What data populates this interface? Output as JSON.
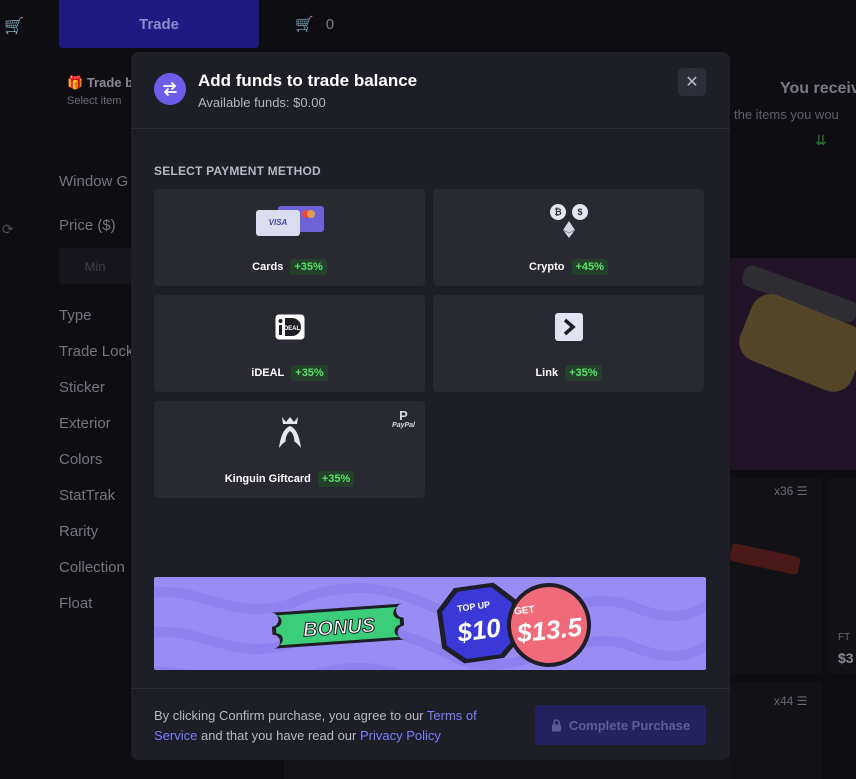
{
  "background": {
    "trade_button": "Trade",
    "cart_count": "0",
    "trade_box_title": "Trade b",
    "trade_box_sub": "Select item",
    "filters": [
      "Window G",
      "Price ($)",
      "Type",
      "Trade Lock",
      "Sticker",
      "Exterior",
      "Colors",
      "StatTrak",
      "Rarity",
      "Collection",
      "Float"
    ],
    "min_placeholder": "Min",
    "right_title": "You receiv",
    "right_subtitle": "the items you wou",
    "item_count_1": "x36",
    "item_count_2": "x44",
    "item_wear": "FT",
    "item_price": "$3"
  },
  "modal": {
    "title": "Add funds to trade balance",
    "subtitle": "Available funds: $0.00",
    "section_label": "SELECT PAYMENT METHOD",
    "methods": [
      {
        "name": "Cards",
        "bonus": "+35%",
        "icon": "cards-icon"
      },
      {
        "name": "Crypto",
        "bonus": "+45%",
        "icon": "crypto-icon"
      },
      {
        "name": "iDEAL",
        "bonus": "+35%",
        "icon": "ideal-icon"
      },
      {
        "name": "Link",
        "bonus": "+35%",
        "icon": "link-icon"
      },
      {
        "name": "Kinguin Giftcard",
        "bonus": "+35%",
        "icon": "kinguin-icon",
        "badge": "PayPal"
      }
    ],
    "banner": {
      "bonus": "BONUS",
      "topup_label": "TOP UP",
      "topup_amount": "$10",
      "get_label": "GET",
      "get_amount": "$13.5"
    },
    "footer": {
      "terms_prefix": "By clicking Confirm purchase, you agree to our ",
      "terms_link": "Terms of Service",
      "terms_middle": " and that you have read our ",
      "privacy_link": "Privacy Policy",
      "complete_button": "Complete Purchase"
    }
  },
  "colors": {
    "accent": "#6c5ce7",
    "bonus_green": "#54e368",
    "modal_bg": "#1e1e26",
    "card_bg": "#292932",
    "banner_bg": "#9a8cf5"
  }
}
